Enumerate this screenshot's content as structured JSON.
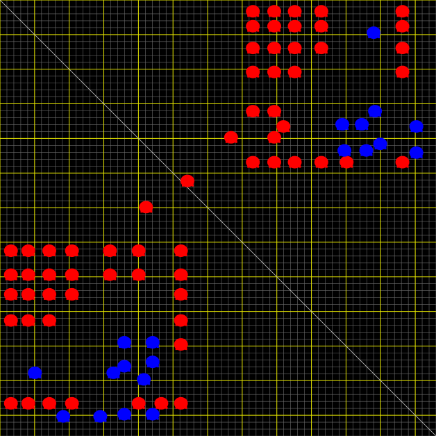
{
  "colors": {
    "background": "#000000",
    "grid_minor": "#6b6b6b",
    "grid_major": "#e6e600",
    "diagonal": "#bdbdbd",
    "positive_signal": "#ff0000",
    "negative_signal": "#0000ff"
  },
  "view": {
    "icon": "contact-map"
  },
  "chart_data": {
    "type": "heatmap",
    "title": "",
    "xlabel": "",
    "ylabel": "",
    "grid": true,
    "minor_divisions": 63,
    "major_every": 5,
    "series": [
      {
        "name": "",
        "color": "#ff0000",
        "sign": "positive",
        "points": [
          [
            0.58,
            0.026
          ],
          [
            0.629,
            0.026
          ],
          [
            0.676,
            0.026
          ],
          [
            0.737,
            0.026
          ],
          [
            0.923,
            0.026
          ],
          [
            0.58,
            0.06
          ],
          [
            0.629,
            0.06
          ],
          [
            0.676,
            0.06
          ],
          [
            0.737,
            0.06
          ],
          [
            0.923,
            0.06
          ],
          [
            0.58,
            0.11
          ],
          [
            0.629,
            0.11
          ],
          [
            0.676,
            0.11
          ],
          [
            0.737,
            0.11
          ],
          [
            0.923,
            0.11
          ],
          [
            0.58,
            0.165
          ],
          [
            0.629,
            0.165
          ],
          [
            0.676,
            0.165
          ],
          [
            0.923,
            0.165
          ],
          [
            0.58,
            0.255
          ],
          [
            0.629,
            0.255
          ],
          [
            0.65,
            0.29
          ],
          [
            0.629,
            0.315
          ],
          [
            0.58,
            0.372
          ],
          [
            0.629,
            0.372
          ],
          [
            0.676,
            0.372
          ],
          [
            0.737,
            0.372
          ],
          [
            0.795,
            0.372
          ],
          [
            0.923,
            0.372
          ],
          [
            0.53,
            0.315
          ],
          [
            0.43,
            0.415
          ],
          [
            0.335,
            0.475
          ],
          [
            0.025,
            0.575
          ],
          [
            0.065,
            0.575
          ],
          [
            0.113,
            0.575
          ],
          [
            0.165,
            0.575
          ],
          [
            0.252,
            0.575
          ],
          [
            0.318,
            0.575
          ],
          [
            0.415,
            0.575
          ],
          [
            0.025,
            0.63
          ],
          [
            0.065,
            0.63
          ],
          [
            0.113,
            0.63
          ],
          [
            0.165,
            0.63
          ],
          [
            0.252,
            0.63
          ],
          [
            0.318,
            0.63
          ],
          [
            0.415,
            0.63
          ],
          [
            0.025,
            0.675
          ],
          [
            0.065,
            0.675
          ],
          [
            0.113,
            0.675
          ],
          [
            0.165,
            0.675
          ],
          [
            0.415,
            0.675
          ],
          [
            0.025,
            0.735
          ],
          [
            0.065,
            0.735
          ],
          [
            0.113,
            0.735
          ],
          [
            0.415,
            0.735
          ],
          [
            0.415,
            0.79
          ],
          [
            0.025,
            0.925
          ],
          [
            0.065,
            0.925
          ],
          [
            0.113,
            0.925
          ],
          [
            0.165,
            0.925
          ],
          [
            0.318,
            0.925
          ],
          [
            0.37,
            0.925
          ],
          [
            0.415,
            0.925
          ]
        ]
      },
      {
        "name": "",
        "color": "#0000ff",
        "sign": "negative",
        "points": [
          [
            0.785,
            0.285
          ],
          [
            0.83,
            0.285
          ],
          [
            0.86,
            0.255
          ],
          [
            0.79,
            0.345
          ],
          [
            0.84,
            0.345
          ],
          [
            0.872,
            0.33
          ],
          [
            0.955,
            0.29
          ],
          [
            0.955,
            0.35
          ],
          [
            0.857,
            0.075
          ],
          [
            0.285,
            0.785
          ],
          [
            0.35,
            0.785
          ],
          [
            0.35,
            0.83
          ],
          [
            0.285,
            0.84
          ],
          [
            0.26,
            0.855
          ],
          [
            0.33,
            0.87
          ],
          [
            0.285,
            0.95
          ],
          [
            0.35,
            0.95
          ],
          [
            0.23,
            0.955
          ],
          [
            0.08,
            0.855
          ],
          [
            0.145,
            0.955
          ]
        ]
      }
    ]
  }
}
